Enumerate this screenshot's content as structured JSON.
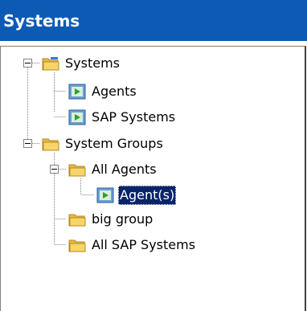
{
  "window": {
    "title": "Systems"
  },
  "tree": {
    "systems": {
      "label": "Systems",
      "children": [
        {
          "label": "Agents"
        },
        {
          "label": "SAP Systems"
        }
      ]
    },
    "system_groups": {
      "label": "System Groups",
      "all_agents": {
        "label": "All Agents",
        "children": [
          {
            "label": "Agent(s)",
            "selected": true
          }
        ]
      },
      "children": [
        {
          "label": "big group"
        },
        {
          "label": "All SAP Systems"
        }
      ]
    }
  },
  "colors": {
    "titlebar": "#0c5ab4",
    "selection": "#0a246a",
    "folder": "#f2c94c",
    "item_icon": "#2f9e32"
  },
  "icons": {
    "folder": "folder-icon",
    "item": "play-item-icon",
    "collapse": "collapse-minus-icon"
  }
}
